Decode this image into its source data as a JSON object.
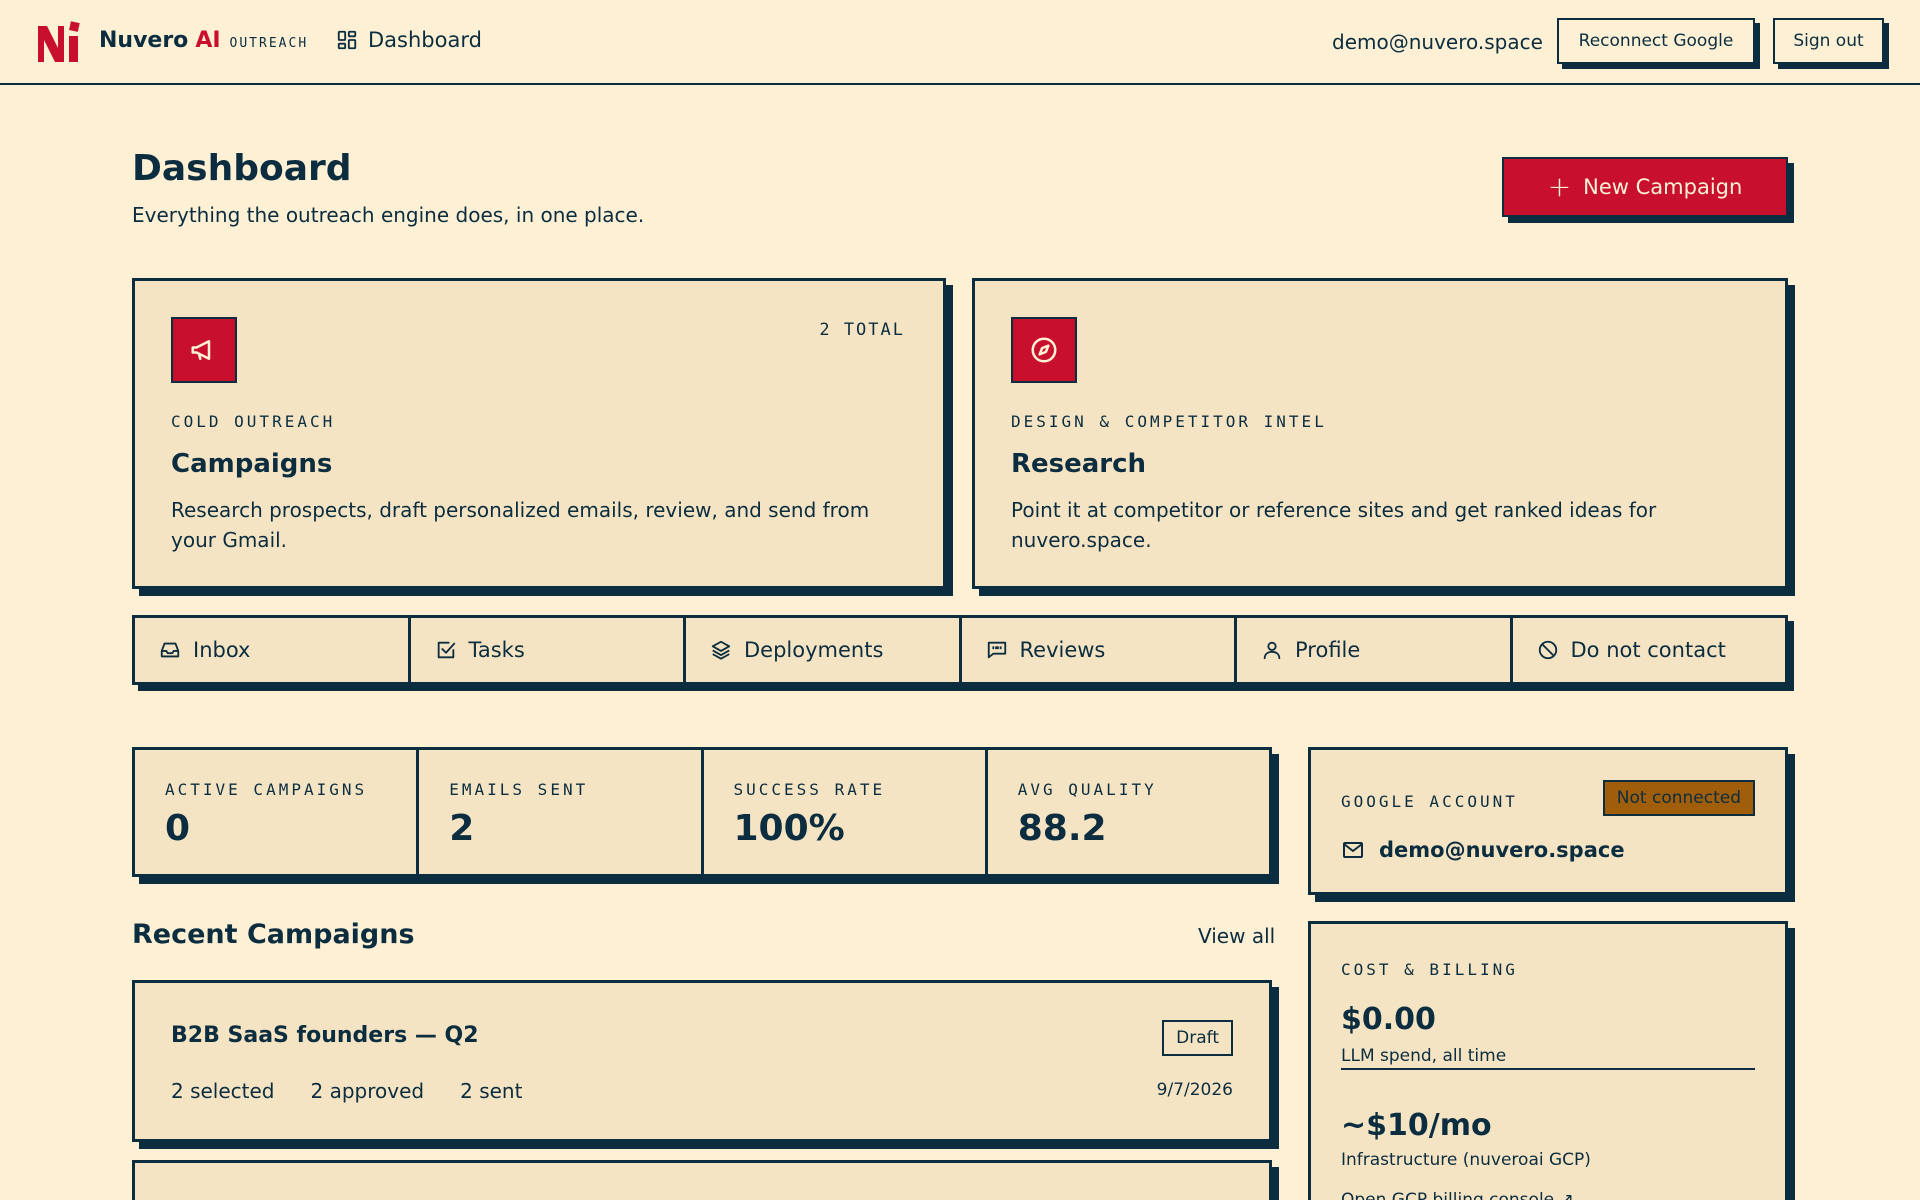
{
  "brand": {
    "name": "Nuvero",
    "ai": "AI",
    "sub": "OUTREACH"
  },
  "nav": {
    "dashboard": "Dashboard"
  },
  "user": {
    "email": "demo@nuvero.space"
  },
  "top_buttons": {
    "reconnect": "Reconnect Google",
    "sign_out": "Sign out"
  },
  "header": {
    "title": "Dashboard",
    "subtitle": "Everything the outreach engine does, in one place.",
    "new_campaign": "New Campaign"
  },
  "features": [
    {
      "icon": "megaphone-icon",
      "count": "2 TOTAL",
      "kicker": "COLD OUTREACH",
      "title": "Campaigns",
      "description": "Research prospects, draft personalized emails, review, and send from your Gmail."
    },
    {
      "icon": "compass-icon",
      "kicker": "DESIGN & COMPETITOR INTEL",
      "title": "Research",
      "description": "Point it at competitor or reference sites and get ranked ideas for nuvero.space."
    }
  ],
  "quick_links": [
    {
      "label": "Inbox",
      "icon": "inbox-icon"
    },
    {
      "label": "Tasks",
      "icon": "checkbox-icon"
    },
    {
      "label": "Deployments",
      "icon": "layers-icon"
    },
    {
      "label": "Reviews",
      "icon": "quote-bubble-icon"
    },
    {
      "label": "Profile",
      "icon": "user-icon"
    },
    {
      "label": "Do not contact",
      "icon": "ban-icon"
    }
  ],
  "stats": [
    {
      "label": "ACTIVE CAMPAIGNS",
      "value": "0"
    },
    {
      "label": "EMAILS SENT",
      "value": "2"
    },
    {
      "label": "SUCCESS RATE",
      "value": "100%"
    },
    {
      "label": "AVG QUALITY",
      "value": "88.2"
    }
  ],
  "recent": {
    "title": "Recent Campaigns",
    "view_all": "View all",
    "items": [
      {
        "name": "B2B SaaS founders — Q2",
        "status": "Draft",
        "selected": "2 selected",
        "approved": "2 approved",
        "sent": "2 sent",
        "date": "9/7/2026"
      }
    ]
  },
  "google_account": {
    "label": "GOOGLE ACCOUNT",
    "status": "Not connected",
    "email": "demo@nuvero.space"
  },
  "billing": {
    "label": "COST & BILLING",
    "llm_amount": "$0.00",
    "llm_note": "LLM spend, all time",
    "infra_amount": "~$10/mo",
    "infra_note": "Infrastructure (nuveroai GCP)",
    "gcp_link": "Open GCP billing console ↗"
  },
  "colors": {
    "background": "#fdf0d5",
    "card": "#f5e4c3",
    "ink": "#0b2d3f",
    "accent_red": "#c8102e",
    "warning": "#a05e0b"
  }
}
